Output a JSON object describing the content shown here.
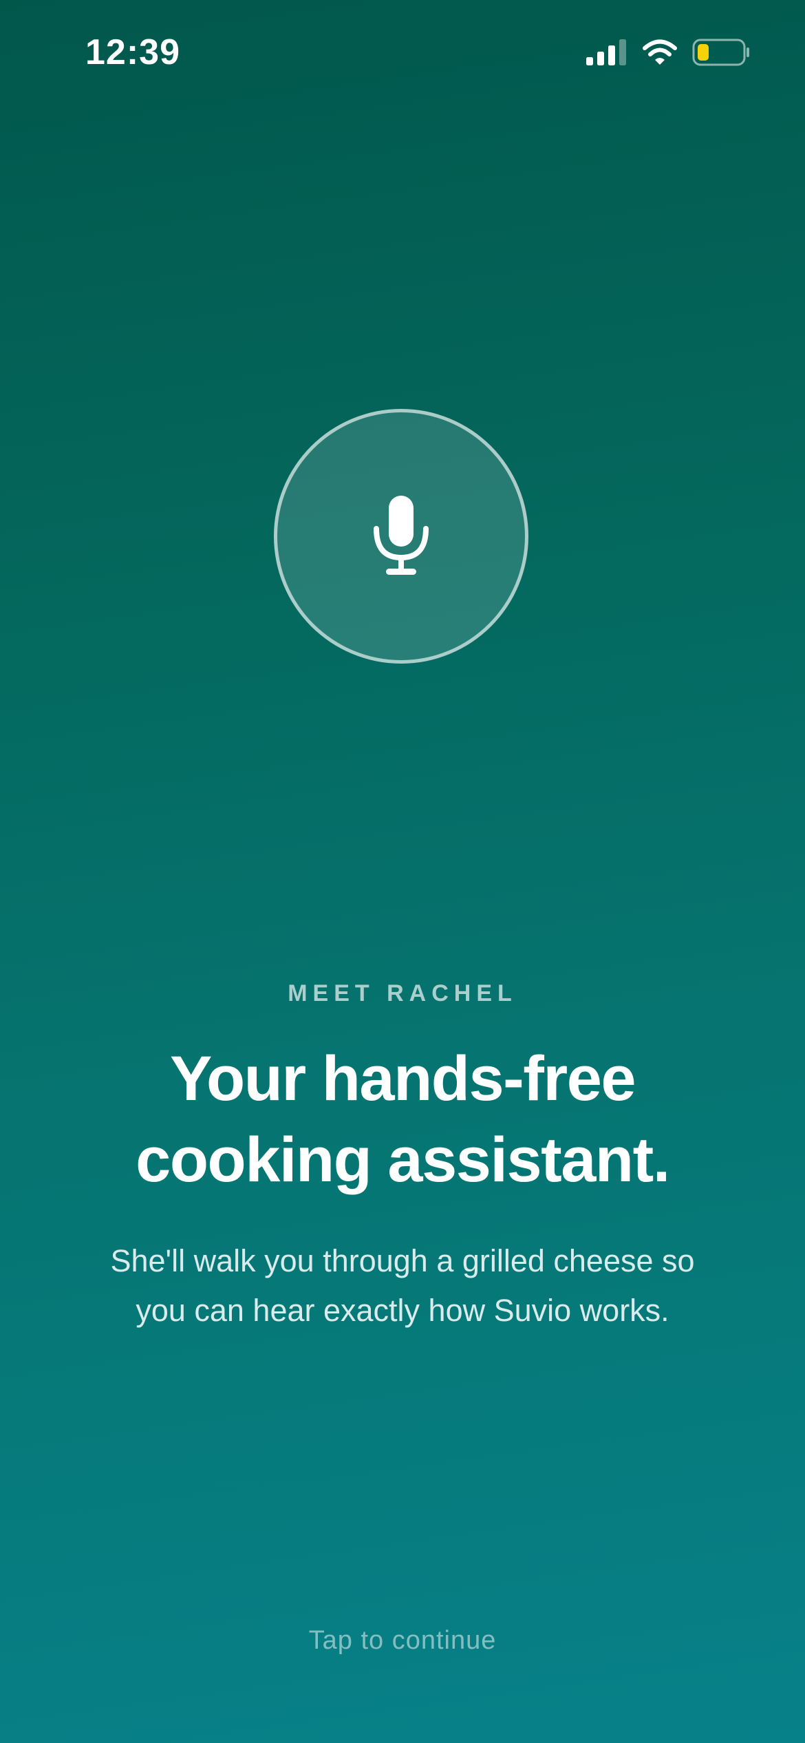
{
  "status_bar": {
    "time": "12:39",
    "icons": [
      "signal-icon",
      "wifi-icon",
      "battery-icon"
    ],
    "battery_color": "#f5d20a"
  },
  "mic_button": {
    "icon": "microphone-icon"
  },
  "intro": {
    "eyebrow": "MEET RACHEL",
    "headline_lines": [
      "Your hands-free",
      "cooking assistant."
    ],
    "subtitle_lines": [
      "She'll walk you through a grilled cheese so",
      "you can hear exactly how Suvio works."
    ]
  },
  "footer": {
    "tap_label": "Tap to continue"
  },
  "colors": {
    "background_top": "#02574b",
    "background_bottom": "#078189",
    "text": "#ffffff"
  }
}
